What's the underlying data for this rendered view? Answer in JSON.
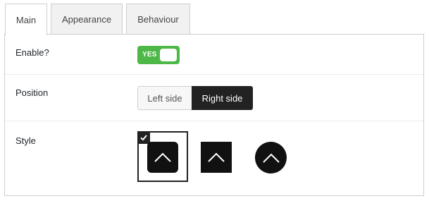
{
  "tabs": [
    {
      "label": "Main",
      "active": true
    },
    {
      "label": "Appearance",
      "active": false
    },
    {
      "label": "Behaviour",
      "active": false
    }
  ],
  "enable": {
    "label": "Enable?",
    "toggle_text": "YES",
    "value": true,
    "color": "#4db847"
  },
  "position": {
    "label": "Position",
    "options": [
      "Left side",
      "Right side"
    ],
    "selected": "Right side"
  },
  "style": {
    "label": "Style",
    "options": [
      {
        "icon": "chevron-up-icon",
        "shape": "rounded-square",
        "selected": true
      },
      {
        "icon": "chevron-up-icon",
        "shape": "square",
        "selected": false
      },
      {
        "icon": "chevron-up-icon",
        "shape": "circle",
        "selected": false
      }
    ]
  }
}
